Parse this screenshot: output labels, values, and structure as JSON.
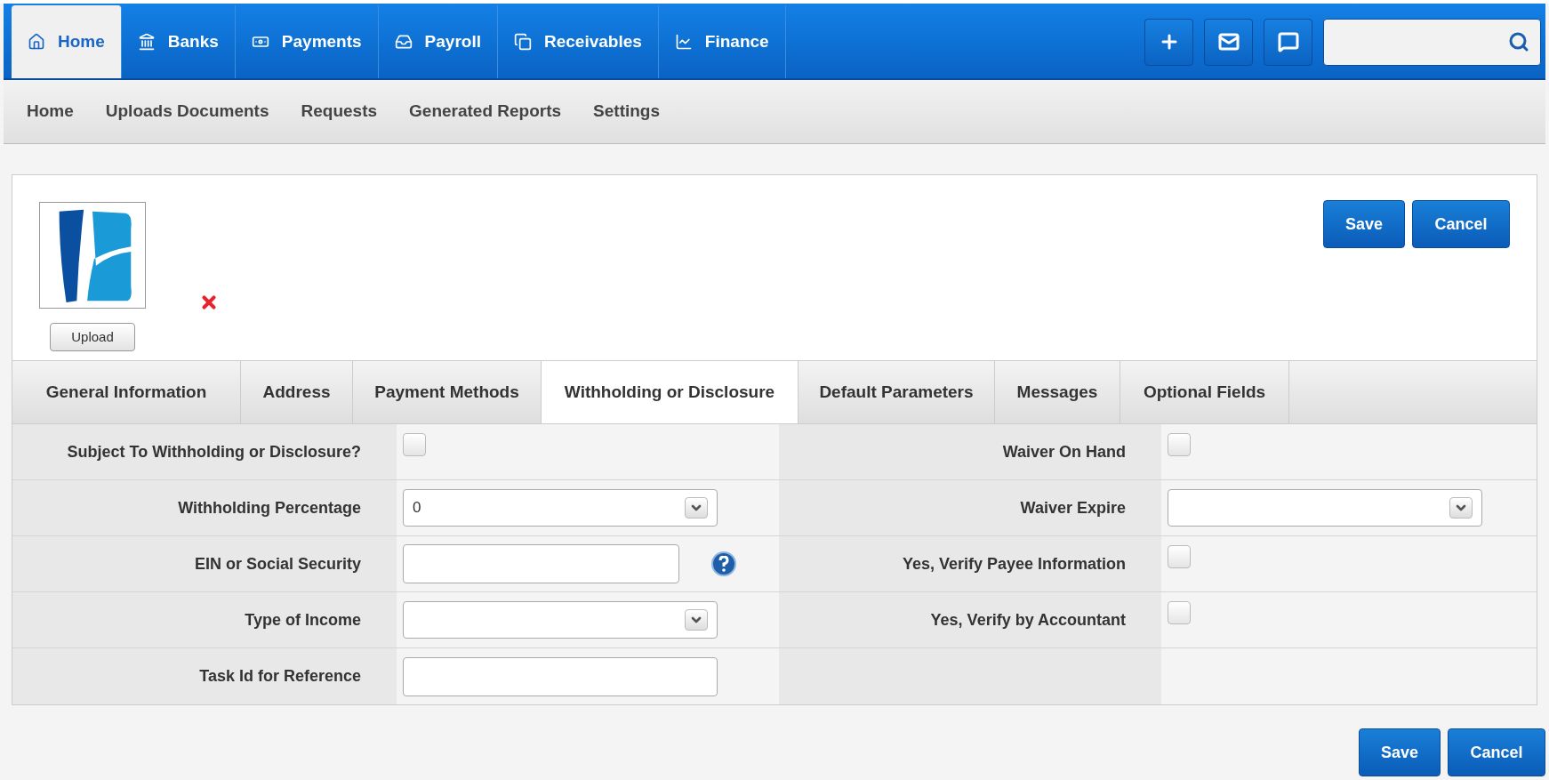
{
  "main_nav": [
    {
      "label": "Home",
      "selected": true
    },
    {
      "label": "Banks",
      "selected": false
    },
    {
      "label": "Payments",
      "selected": false
    },
    {
      "label": "Payroll",
      "selected": false
    },
    {
      "label": "Receivables",
      "selected": false
    },
    {
      "label": "Finance",
      "selected": false
    }
  ],
  "sub_nav": [
    "Home",
    "Uploads Documents",
    "Requests",
    "Generated Reports",
    "Settings"
  ],
  "logo": {
    "upload_button": "Upload"
  },
  "header_buttons": [
    "Save",
    "Cancel"
  ],
  "tabs": [
    {
      "label": "General Information",
      "selected": false
    },
    {
      "label": "Address",
      "selected": false
    },
    {
      "label": "Payment Methods",
      "selected": false
    },
    {
      "label": "Withholding or Disclosure",
      "selected": true
    },
    {
      "label": "Default Parameters",
      "selected": false
    },
    {
      "label": "Messages",
      "selected": false
    },
    {
      "label": "Optional Fields",
      "selected": false
    }
  ],
  "rows": [
    {
      "left": {
        "label": "Subject To Withholding or Disclosure?",
        "kind": "checkbox",
        "checked": false
      },
      "right": {
        "label": "Waiver On Hand",
        "kind": "checkbox",
        "checked": false
      }
    },
    {
      "left": {
        "label": "Withholding Percentage",
        "kind": "select",
        "value": "0"
      },
      "right": {
        "label": "Waiver Expire",
        "kind": "select"
      }
    },
    {
      "left": {
        "label": "EIN or Social Security",
        "kind": "text",
        "help": true
      },
      "right": {
        "label": "Yes, Verify Payee Information",
        "kind": "checkbox",
        "checked": false
      }
    },
    {
      "left": {
        "label": "Type of Income",
        "kind": "select"
      },
      "right": {
        "label": "Yes, Verify by Accountant",
        "kind": "checkbox",
        "checked": false
      }
    },
    {
      "left": {
        "label": "Task Id for Reference",
        "kind": "text"
      }
    }
  ],
  "footer_buttons": [
    "Save",
    "Cancel"
  ]
}
